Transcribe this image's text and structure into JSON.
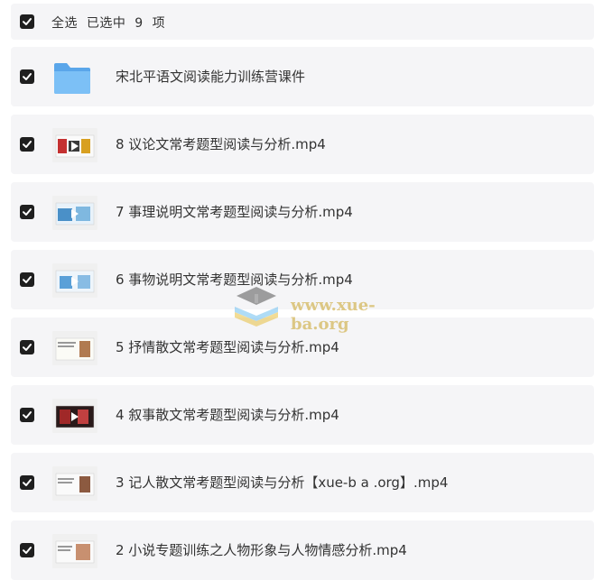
{
  "header": {
    "text": "全选  已选中  9  项"
  },
  "items": [
    {
      "name": "宋北平语文阅读能力训练营课件",
      "type": "folder"
    },
    {
      "name": "8 议论文常考题型阅读与分析.mp4",
      "type": "video"
    },
    {
      "name": "7 事理说明文常考题型阅读与分析.mp4",
      "type": "video"
    },
    {
      "name": "6 事物说明文常考题型阅读与分析.mp4",
      "type": "video"
    },
    {
      "name": "5 抒情散文常考题型阅读与分析.mp4",
      "type": "video"
    },
    {
      "name": "4 叙事散文常考题型阅读与分析.mp4",
      "type": "video"
    },
    {
      "name": "3 记人散文常考题型阅读与分析【xue-b a .org】.mp4",
      "type": "video"
    },
    {
      "name": "2 小说专题训练之人物形象与人物情感分析.mp4",
      "type": "video"
    }
  ],
  "watermark": {
    "text": "www.xue-ba.org"
  },
  "colors": {
    "row_bg": "#f5f5f7",
    "checkbox": "#1f1f1f",
    "folder": "#6cb4f2"
  }
}
